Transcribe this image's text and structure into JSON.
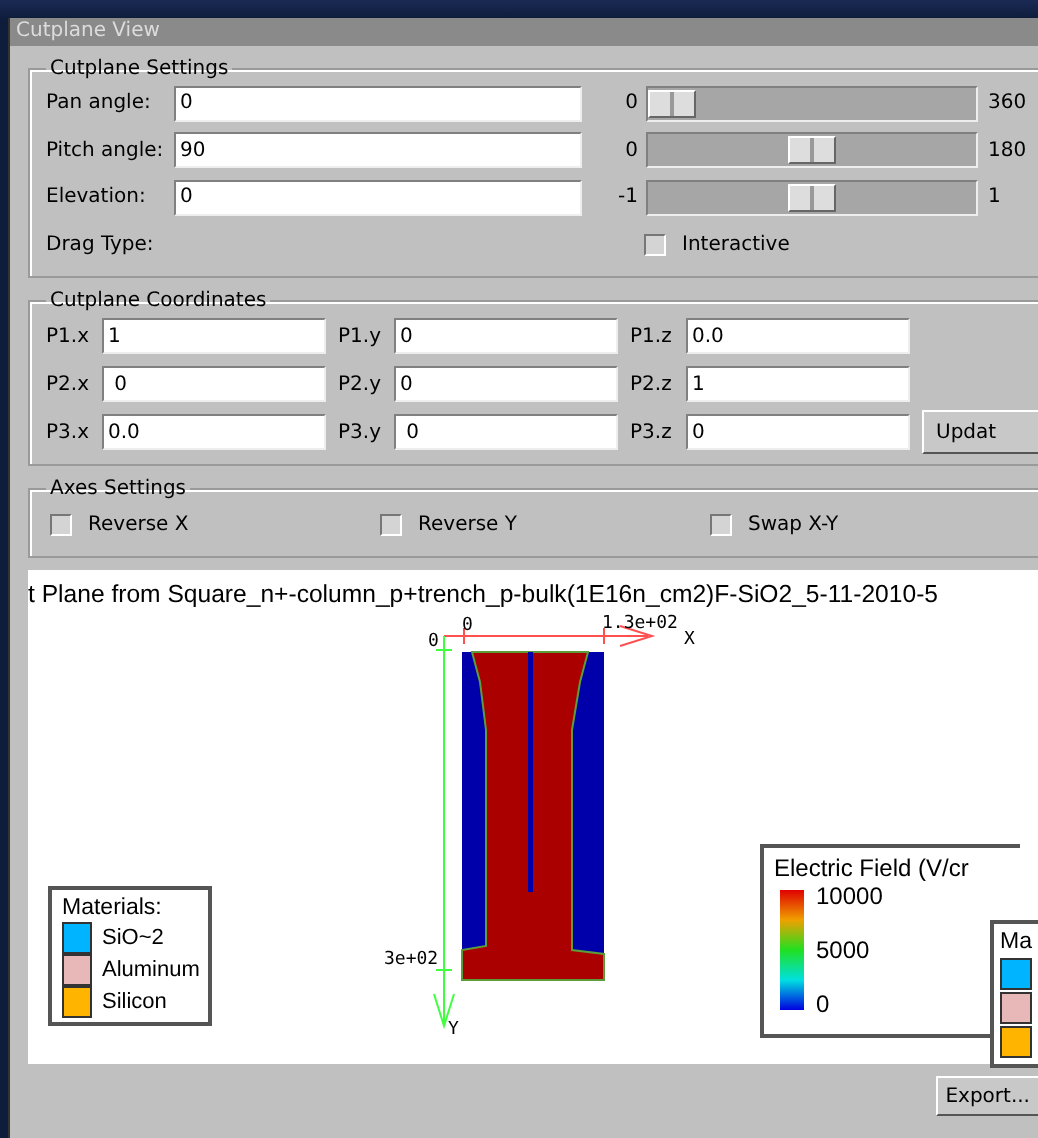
{
  "window": {
    "title": "Cutplane View"
  },
  "cutplane_settings": {
    "title": "Cutplane Settings",
    "rows": [
      {
        "label": "Pan angle:",
        "value": "0",
        "min": "0",
        "max": "360",
        "level": 0
      },
      {
        "label": "Pitch angle:",
        "value": "90",
        "min": "0",
        "max": "180",
        "level": 0.5
      },
      {
        "label": "Elevation:",
        "value": "0",
        "min": "-1",
        "max": "1",
        "level": 0.5
      }
    ],
    "drag_type": {
      "label": "Drag Type:",
      "option": "Interactive",
      "checked": false
    }
  },
  "cutplane_coordinates": {
    "title": "Cutplane Coordinates",
    "rows": [
      [
        {
          "label": "P1.x",
          "value": "1"
        },
        {
          "label": "P1.y",
          "value": "0"
        },
        {
          "label": "P1.z",
          "value": "0.0"
        }
      ],
      [
        {
          "label": "P2.x",
          "value": " 0"
        },
        {
          "label": "P2.y",
          "value": "0"
        },
        {
          "label": "P2.z",
          "value": "1"
        }
      ],
      [
        {
          "label": "P3.x",
          "value": "0.0"
        },
        {
          "label": "P3.y",
          "value": " 0"
        },
        {
          "label": "P3.z",
          "value": "0"
        }
      ]
    ],
    "button": "Updat"
  },
  "axes_settings": {
    "title": "Axes Settings",
    "options": [
      {
        "label": "Reverse X",
        "checked": false
      },
      {
        "label": "Reverse Y",
        "checked": false
      },
      {
        "label": "Swap X-Y",
        "checked": false
      }
    ]
  },
  "plot": {
    "title": "t Plane from Square_n+-column_p+trench_p-bulk(1E16n_cm2)F-SiO2_5-11-2010-5",
    "axis_labels": {
      "origin": "0",
      "x_start": "0",
      "x_end": "1.3e+02",
      "x_name": "X",
      "y_end": "3e+02",
      "y_name": "Y"
    },
    "materials": {
      "title": "Materials:",
      "items": [
        {
          "name": "SiO~2",
          "color": "#00b4ff"
        },
        {
          "name": "Aluminum",
          "color": "#e8b8b8"
        },
        {
          "name": "Silicon",
          "color": "#ffb400"
        }
      ]
    },
    "field_legend": {
      "title": "Electric Field (V/cr",
      "ticks": [
        "10000",
        "5000",
        "0"
      ]
    },
    "second_legend": {
      "title": "Ma"
    }
  },
  "buttons": [
    "Export..."
  ]
}
